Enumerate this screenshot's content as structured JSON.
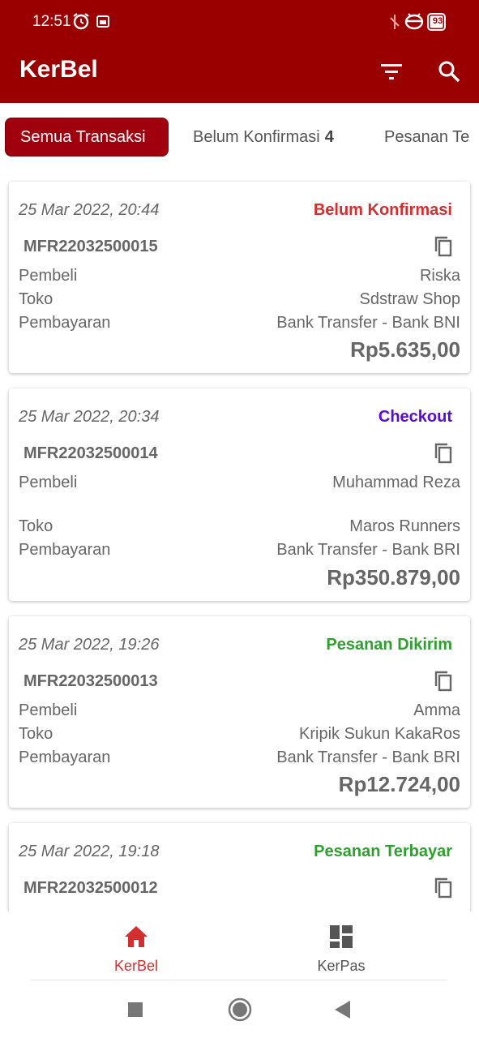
{
  "status_bar": {
    "time": "12:51",
    "battery": "93"
  },
  "app_bar": {
    "title": "KerBel"
  },
  "tabs": [
    {
      "label": "Semua Transaksi",
      "count": ""
    },
    {
      "label": "Belum Konfirmasi",
      "count": "4"
    },
    {
      "label": "Pesanan Te",
      "count": ""
    }
  ],
  "labels": {
    "buyer": "Pembeli",
    "store": "Toko",
    "payment": "Pembayaran"
  },
  "transactions": [
    {
      "date": "25 Mar 2022, 20:44",
      "status": "Belum Konfirmasi",
      "code": "MFR22032500015",
      "buyer": "Riska",
      "store": "Sdstraw Shop",
      "payment": "Bank Transfer - Bank BNI",
      "amount": "Rp5.635,00"
    },
    {
      "date": "25 Mar 2022, 20:34",
      "status": "Checkout",
      "code": "MFR22032500014",
      "buyer": "Muhammad Reza",
      "store": "Maros Runners",
      "payment": "Bank Transfer - Bank BRI",
      "amount": "Rp350.879,00"
    },
    {
      "date": "25 Mar 2022, 19:26",
      "status": "Pesanan Dikirim",
      "code": "MFR22032500013",
      "buyer": "Amma",
      "store": "Kripik Sukun KakaRos",
      "payment": "Bank Transfer - Bank BRI",
      "amount": "Rp12.724,00"
    },
    {
      "date": "25 Mar 2022, 19:18",
      "status": "Pesanan Terbayar",
      "code": "MFR22032500012",
      "buyer": "",
      "store": "",
      "payment": "",
      "amount": ""
    }
  ],
  "status_colors": {
    "belum": "#d32f2f",
    "checkout": "#5b0bd1",
    "dikirim": "#2ea02e",
    "terbayar": "#2ea02e"
  },
  "bottom_nav": [
    {
      "label": "KerBel",
      "icon": "home-icon",
      "active": true
    },
    {
      "label": "KerPas",
      "icon": "dashboard-icon",
      "active": false
    }
  ],
  "colors": {
    "brand": "#9b0000",
    "active_nav": "#d32f2f",
    "inactive_nav": "#555555"
  }
}
